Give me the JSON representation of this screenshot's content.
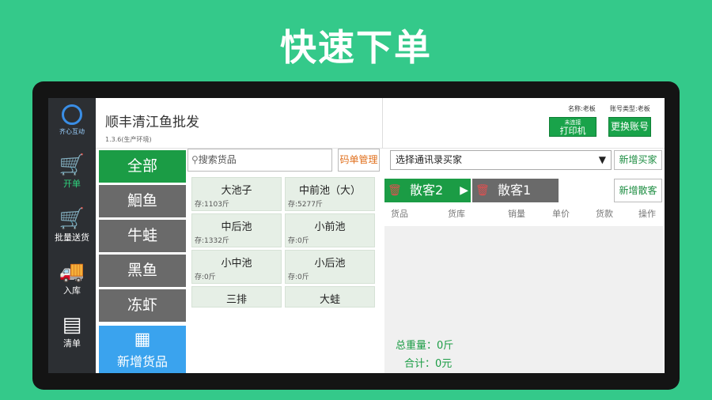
{
  "headline": "快速下单",
  "logo_text": "齐心互动",
  "nav": [
    {
      "label": "开单",
      "icon": "cart-icon"
    },
    {
      "label": "批量送货",
      "icon": "cart-icon"
    },
    {
      "label": "入库",
      "icon": "truck-icon"
    },
    {
      "label": "清单",
      "icon": "list-icon"
    }
  ],
  "header": {
    "shop_title": "顺丰清江鱼批发",
    "version": "1.3.6(生产环境)",
    "account_name": "名称:老板",
    "account_type": "账号类型:老板",
    "printer_status": "未连接",
    "printer_label": "打印机",
    "switch_label": "更换账号"
  },
  "categories": [
    "全部",
    "鮰鱼",
    "牛蛙",
    "黑鱼",
    "冻虾"
  ],
  "add_goods_label": "新增货品",
  "search_placeholder": "搜索货品",
  "code_mgr_label": "码单管理",
  "goods": [
    {
      "name": "大池子",
      "stock": "存:1103斤"
    },
    {
      "name": "中前池（大）",
      "stock": "存:5277斤"
    },
    {
      "name": "中后池",
      "stock": "存:1332斤"
    },
    {
      "name": "小前池",
      "stock": "存:0斤"
    },
    {
      "name": "小中池",
      "stock": "存:0斤"
    },
    {
      "name": "小后池",
      "stock": "存:0斤"
    },
    {
      "name": "三排",
      "stock": ""
    },
    {
      "name": "大蛙",
      "stock": ""
    }
  ],
  "buyer_select": "选择通讯录买家",
  "add_buyer_label": "新增买家",
  "add_walkin_label": "新增散客",
  "order_tabs": [
    "散客2",
    "散客1"
  ],
  "columns": [
    "货品",
    "货库",
    "销量",
    "单价",
    "货款",
    "操作"
  ],
  "total_weight": "总重量：0斤",
  "total_amount": "合计：0元",
  "colors": {
    "accent": "#1b9c45",
    "background": "#34c98a",
    "blue": "#3aa3ee"
  }
}
